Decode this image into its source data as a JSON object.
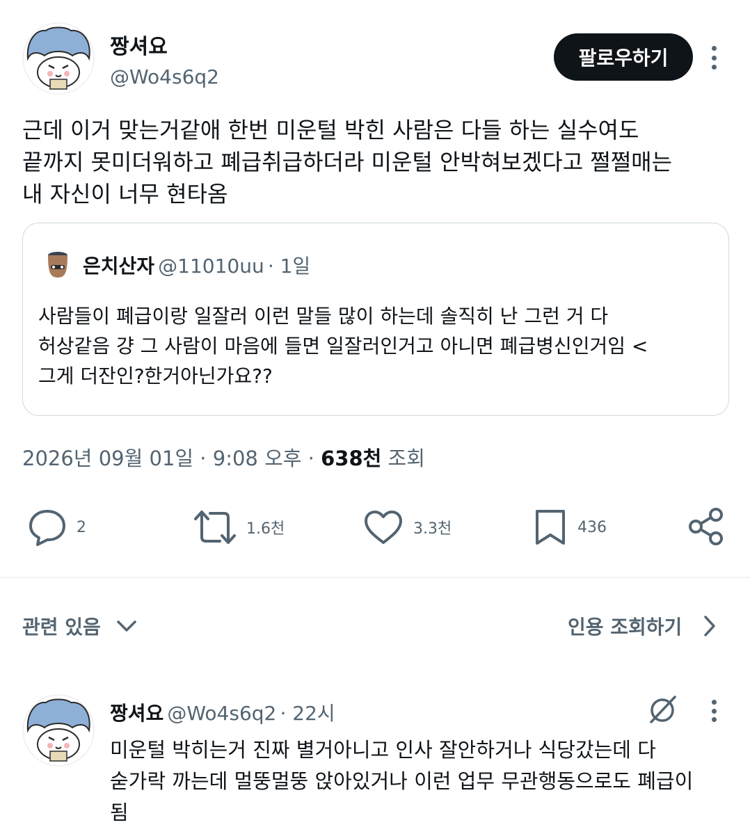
{
  "tweet": {
    "author_name": "짱셔요",
    "author_handle": "@Wo4s6q2",
    "follow_label": "팔로우하기",
    "text": "근데 이거 맞는거같애 한번 미운털 박힌 사람은 다들 하는 실수여도\n끝까지 못미더워하고 폐급취급하더라 미운털 안박혀보겠다고 쩔쩔매는\n내 자신이 너무 현타옴",
    "timestamp": "2026년 09월 01일 · 9:08 오후",
    "dot": "·",
    "views_count": "638천",
    "views_label": "조회"
  },
  "quote": {
    "author_name": "은치산자",
    "author_handle": "@11010uu",
    "time": "· 1일",
    "text": "사람들이 폐급이랑 일잘러 이런 말들 많이 하는데 솔직히 난 그런 거 다\n허상같음 걍 그 사람이 마음에 들면 일잘러인거고 아니면 폐급병신인거임 <\n그게 더잔인?한거아닌가요??"
  },
  "actions": {
    "replies": "2",
    "retweets": "1.6천",
    "likes": "3.3천",
    "bookmarks": "436"
  },
  "related": {
    "label": "관련 있음",
    "quotes_label": "인용 조회하기"
  },
  "reply": {
    "author_name": "짱셔요",
    "author_handle": "@Wo4s6q2",
    "time": "· 22시",
    "text": "미운털 박히는거 진짜 별거아니고 인사 잘안하거나 식당갔는데 다\n숟가락 까는데 멀뚱멀뚱 앉아있거나 이런 업무 무관행동으로도 폐급이\n됨"
  },
  "colors": {
    "text_primary": "#0f1419",
    "text_secondary": "#536471",
    "border": "#cfd9de",
    "divider": "#eff3f4",
    "avatar_hat": "#8fb0d6"
  }
}
